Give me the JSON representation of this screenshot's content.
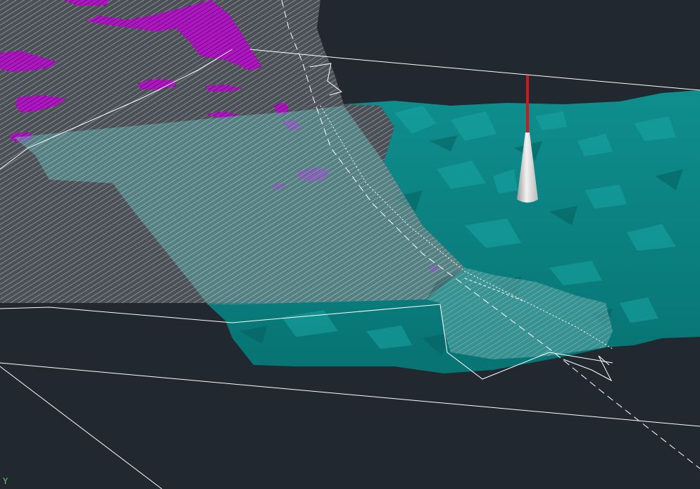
{
  "viewport": {
    "background": "#212830",
    "ucs_icon": "ucs-axis-icon",
    "ucs_axis_label": "Y"
  },
  "colors": {
    "hatch_plane": "#8a8f94",
    "hatch_plane_fill": "#4a4f55",
    "magenta_regions": "#c21bd6",
    "terrain": "#0e8c8c",
    "terrain_light": "#1aa5a3",
    "translucent_overlay": "#6fb6b6",
    "cone_body": "#e4e4e4",
    "red_marker": "#d01818",
    "boundary_lines": "#ffffff"
  }
}
